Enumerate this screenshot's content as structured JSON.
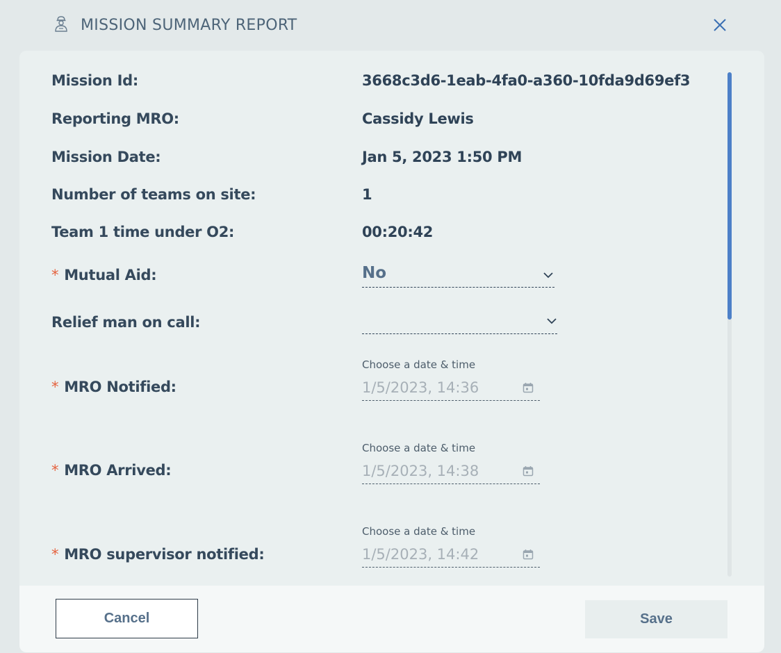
{
  "dialog": {
    "title": "MISSION SUMMARY REPORT",
    "header_icon": "user-helmet-icon",
    "close_icon": "close-icon"
  },
  "fields": {
    "mission_id": {
      "label": "Mission Id:",
      "value": "3668c3d6-1eab-4fa0-a360-10fda9d69ef3"
    },
    "reporting_mro": {
      "label": "Reporting MRO:",
      "value": "Cassidy Lewis"
    },
    "mission_date": {
      "label": "Mission Date:",
      "value": "Jan 5, 2023 1:50 PM"
    },
    "teams_on_site": {
      "label": "Number of teams on site:",
      "value": "1"
    },
    "team1_o2": {
      "label": "Team 1 time under O2:",
      "value": "00:20:42"
    },
    "mutual_aid": {
      "required_mark": "*",
      "label": "Mutual Aid:",
      "value": "No"
    },
    "relief_man": {
      "label": "Relief man on call:",
      "value": ""
    },
    "mro_notified": {
      "required_mark": "*",
      "label": "MRO Notified:",
      "hint": "Choose a date & time",
      "value": "1/5/2023, 14:36"
    },
    "mro_arrived": {
      "required_mark": "*",
      "label": "MRO Arrived:",
      "hint": "Choose a date & time",
      "value": "1/5/2023, 14:38"
    },
    "mro_supervisor_notified": {
      "required_mark": "*",
      "label": "MRO supervisor notified:",
      "hint": "Choose a date & time",
      "value": "1/5/2023, 14:42"
    }
  },
  "footer": {
    "cancel_label": "Cancel",
    "save_label": "Save"
  },
  "colors": {
    "required": "#e5623e",
    "scroll_thumb": "#4d80c8",
    "label_text": "#35495c"
  }
}
